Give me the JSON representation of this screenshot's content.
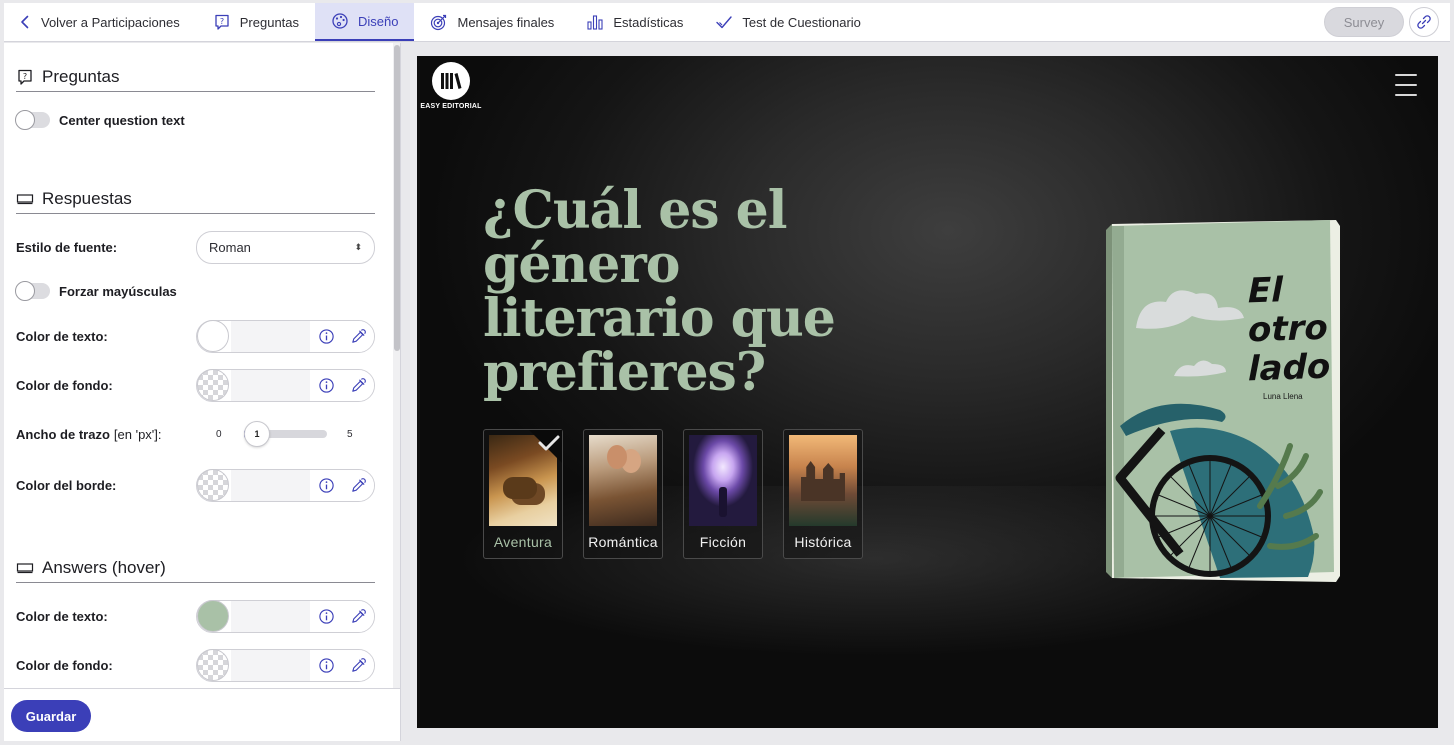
{
  "nav": {
    "back_label": "Volver a Participaciones",
    "tabs": [
      {
        "label": "Preguntas",
        "icon": "question-bubble-icon"
      },
      {
        "label": "Diseño",
        "icon": "palette-icon"
      },
      {
        "label": "Mensajes finales",
        "icon": "target-icon"
      },
      {
        "label": "Estadísticas",
        "icon": "bar-chart-icon"
      },
      {
        "label": "Test de Cuestionario",
        "icon": "check-icon"
      }
    ],
    "active_tab": "Diseño",
    "survey_label": "Survey"
  },
  "panel": {
    "questions_section": {
      "title": "Preguntas",
      "center_text_label": "Center question text",
      "center_text_on": false
    },
    "answers_section": {
      "title": "Respuestas",
      "font_style_label": "Estilo de fuente:",
      "font_style_value": "Roman",
      "uppercase_label": "Forzar mayúsculas",
      "uppercase_on": false,
      "text_color_label": "Color de texto:",
      "text_color": "#ffffff",
      "bg_color_label": "Color de fondo:",
      "stroke_label": "Ancho de trazo",
      "stroke_unit": "[en 'px']:",
      "stroke_min": "0",
      "stroke_max": "5",
      "stroke_value": "1",
      "border_color_label": "Color del borde:"
    },
    "hover_section": {
      "title": "Answers (hover)",
      "text_color_label": "Color de texto:",
      "text_color": "#a9c1a7",
      "bg_color_label": "Color de fondo:"
    },
    "save_label": "Guardar"
  },
  "preview": {
    "logo_text": "EASY EDITORIAL",
    "question": "¿Cuál es el género literario que prefieres?",
    "question_color": "#a9c1a7",
    "answers": [
      {
        "label": "Aventura",
        "selected": true
      },
      {
        "label": "Romántica",
        "selected": false
      },
      {
        "label": "Ficción",
        "selected": false
      },
      {
        "label": "Histórica",
        "selected": false
      }
    ],
    "book": {
      "title_lines": [
        "El",
        "otro",
        "lado"
      ],
      "author": "Luna Llena"
    }
  },
  "colors": {
    "accent": "#3b3fb8",
    "active_tab_bg": "#dfe1f6",
    "book_cover": "#a9c1a7"
  }
}
